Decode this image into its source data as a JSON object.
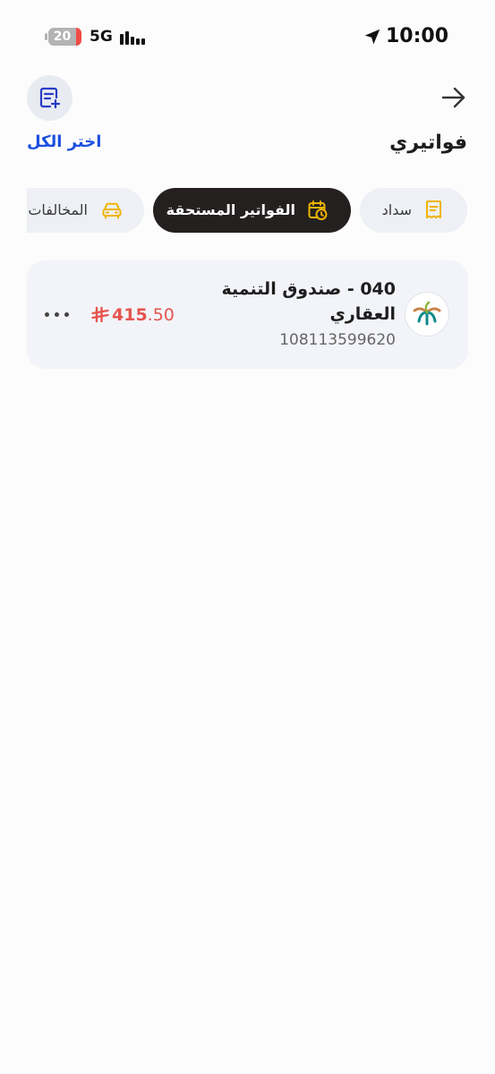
{
  "status_bar": {
    "battery_level": "20",
    "network": "5G",
    "time": "10:00"
  },
  "header": {
    "title": "فواتيري",
    "select_all_label": "اختر الكل",
    "back_icon": "arrow-right-icon",
    "add_bill_icon": "document-plus-icon"
  },
  "tabs": [
    {
      "label": "سداد",
      "icon": "receipt-icon",
      "active": false
    },
    {
      "label": "الفواتير المستحقة",
      "icon": "calendar-clock-icon",
      "active": true
    },
    {
      "label": "المخالفات",
      "icon": "car-icon",
      "active": false
    }
  ],
  "bills": [
    {
      "name": "040 - صندوق التنمية العقاري",
      "number": "108113599620",
      "amount_main": "415",
      "amount_decimals": ".50",
      "currency_icon": "saudi-riyal-icon",
      "more_icon": "more-horizontal-icon",
      "logo": "real-estate-development-fund-logo"
    }
  ],
  "colors": {
    "accent_blue": "#1b4fe0",
    "amount_red": "#e5544e",
    "tab_active_bg": "#23201f",
    "tab_icon_yellow": "#f0b400",
    "card_bg": "#f3f4f9"
  }
}
